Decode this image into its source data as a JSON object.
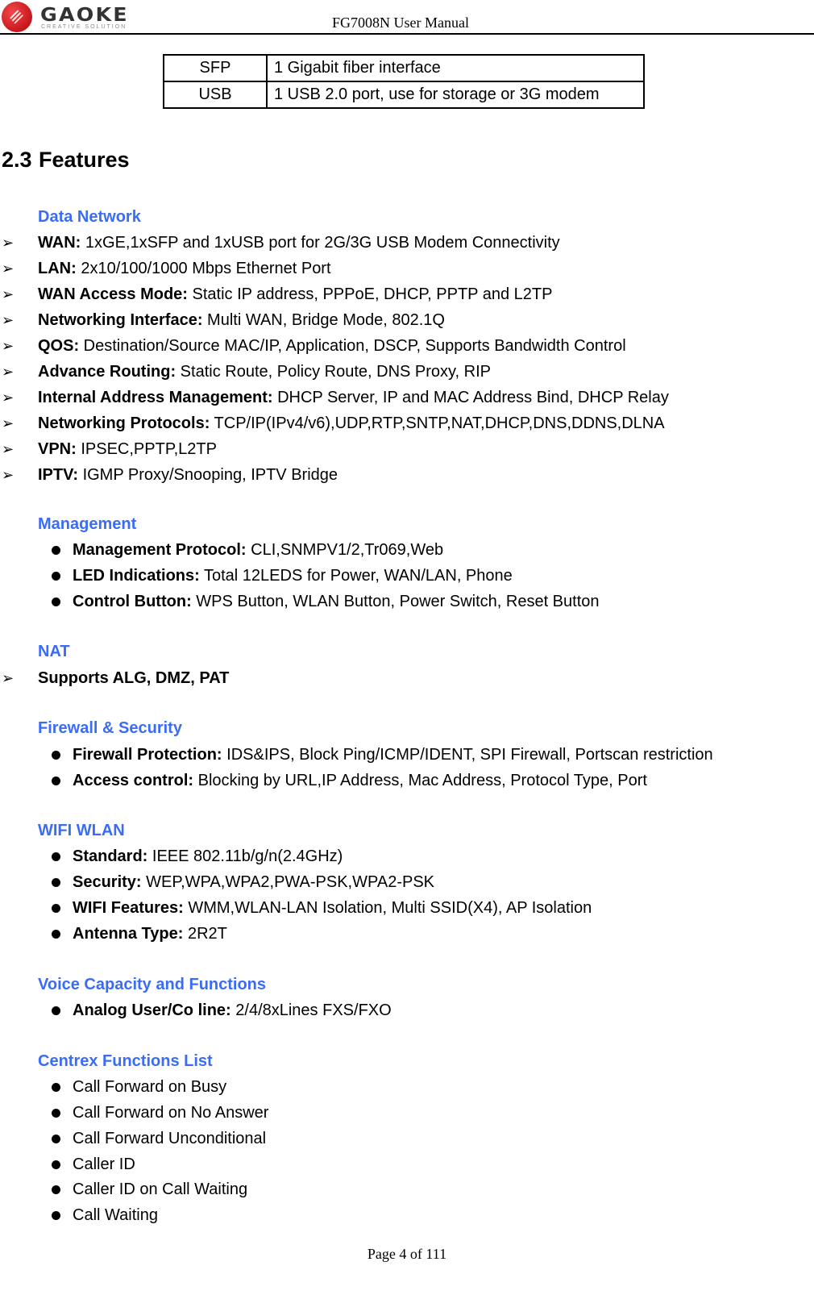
{
  "header": {
    "logo_name": "GAOKE",
    "logo_tagline": "CREATIVE SOLUTION",
    "title": "FG7008N User Manual"
  },
  "spec_table": [
    {
      "key": "SFP",
      "value": "1 Gigabit fiber interface"
    },
    {
      "key": "USB",
      "value": "1 USB 2.0 port, use for storage or 3G modem"
    }
  ],
  "section": {
    "number": "2.3",
    "title": "Features"
  },
  "accent_color": "#3a6cf5",
  "categories": [
    {
      "title": "Data Network",
      "bullet": "arrow",
      "items": [
        {
          "label": "WAN:",
          "text": " 1xGE,1xSFP and 1xUSB port for 2G/3G USB Modem Connectivity"
        },
        {
          "label": "LAN:",
          "text": " 2x10/100/1000 Mbps Ethernet Port"
        },
        {
          "label": "WAN Access Mode:",
          "text": " Static IP address, PPPoE, DHCP, PPTP and L2TP"
        },
        {
          "label": "Networking Interface:",
          "text": " Multi WAN, Bridge Mode, 802.1Q"
        },
        {
          "label": "QOS:",
          "text": " Destination/Source MAC/IP, Application, DSCP, Supports Bandwidth Control"
        },
        {
          "label": "Advance Routing:",
          "text": " Static Route, Policy Route, DNS Proxy, RIP"
        },
        {
          "label": "Internal Address Management:",
          "text": " DHCP Server, IP and MAC Address Bind, DHCP Relay"
        },
        {
          "label": "Networking Protocols:",
          "text": " TCP/IP(IPv4/v6),UDP,RTP,SNTP,NAT,DHCP,DNS,DDNS,DLNA"
        },
        {
          "label": "VPN:",
          "text": " IPSEC,PPTP,L2TP"
        },
        {
          "label": "IPTV:",
          "text": " IGMP Proxy/Snooping, IPTV Bridge"
        }
      ]
    },
    {
      "title": "Management",
      "bullet": "dot",
      "items": [
        {
          "label": "Management Protocol:",
          "text": " CLI,SNMPV1/2,Tr069,Web"
        },
        {
          "label": "LED Indications:",
          "text": " Total 12LEDS for Power, WAN/LAN, Phone"
        },
        {
          "label": "Control Button:",
          "text": " WPS Button, WLAN Button, Power Switch, Reset Button"
        }
      ]
    },
    {
      "title": "NAT",
      "bullet": "arrow",
      "items": [
        {
          "label": "Supports ALG, DMZ, PAT",
          "text": ""
        }
      ]
    },
    {
      "title": "Firewall & Security",
      "bullet": "dot",
      "items": [
        {
          "label": "Firewall Protection:",
          "text": " IDS&IPS, Block Ping/ICMP/IDENT, SPI Firewall, Portscan restriction"
        },
        {
          "label": "Access control:",
          "text": " Blocking by URL,IP Address, Mac Address, Protocol Type, Port"
        }
      ]
    },
    {
      "title": "WIFI WLAN",
      "bullet": "dot",
      "items": [
        {
          "label": "Standard:",
          "text": " IEEE 802.11b/g/n(2.4GHz)"
        },
        {
          "label": "Security:",
          "text": " WEP,WPA,WPA2,PWA-PSK,WPA2-PSK"
        },
        {
          "label": "WIFI Features:",
          "text": " WMM,WLAN-LAN Isolation, Multi SSID(X4), AP Isolation"
        },
        {
          "label": "Antenna Type:",
          "text": " 2R2T"
        }
      ]
    },
    {
      "title": "Voice Capacity and Functions",
      "bullet": "dot",
      "items": [
        {
          "label": "Analog User/Co line:",
          "text": " 2/4/8xLines FXS/FXO"
        }
      ]
    },
    {
      "title": "Centrex Functions List",
      "bullet": "dot",
      "items": [
        {
          "label": "",
          "text": "Call Forward on Busy"
        },
        {
          "label": "",
          "text": "Call Forward on No Answer"
        },
        {
          "label": "",
          "text": "Call Forward Unconditional"
        },
        {
          "label": "",
          "text": "Caller ID"
        },
        {
          "label": "",
          "text": "Caller ID on Call Waiting"
        },
        {
          "label": "",
          "text": "Call Waiting"
        }
      ]
    }
  ],
  "footer": {
    "page_label": "Page 4 of 111"
  }
}
